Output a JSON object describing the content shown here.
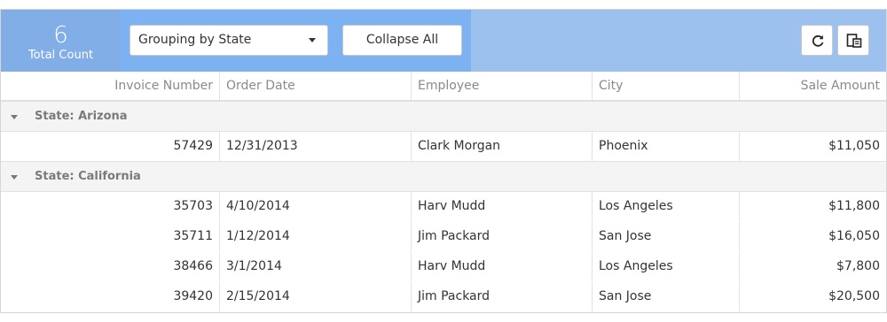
{
  "toolbar": {
    "total_count": "6",
    "total_count_label": "Total Count",
    "grouping_select": "Grouping by State",
    "collapse_label": "Collapse All"
  },
  "icons": {
    "refresh": "refresh-icon",
    "export": "export-icon",
    "group_toggle": "caret-down-icon"
  },
  "colors": {
    "toolbar_bg": "#9cc1ee",
    "count_bg": "#81aee6",
    "group_area_bg": "#7db2f2",
    "group_row_bg": "#f4f4f4"
  },
  "grid": {
    "columns": [
      "Invoice Number",
      "Order Date",
      "Employee",
      "City",
      "Sale Amount"
    ],
    "groups": [
      {
        "label": "State: Arizona",
        "rows": [
          [
            "57429",
            "12/31/2013",
            "Clark Morgan",
            "Phoenix",
            "$11,050"
          ]
        ]
      },
      {
        "label": "State: California",
        "rows": [
          [
            "35703",
            "4/10/2014",
            "Harv Mudd",
            "Los Angeles",
            "$11,800"
          ],
          [
            "35711",
            "1/12/2014",
            "Jim Packard",
            "San Jose",
            "$16,050"
          ],
          [
            "38466",
            "3/1/2014",
            "Harv Mudd",
            "Los Angeles",
            "$7,800"
          ],
          [
            "39420",
            "2/15/2014",
            "Jim Packard",
            "San Jose",
            "$20,500"
          ]
        ]
      }
    ]
  }
}
